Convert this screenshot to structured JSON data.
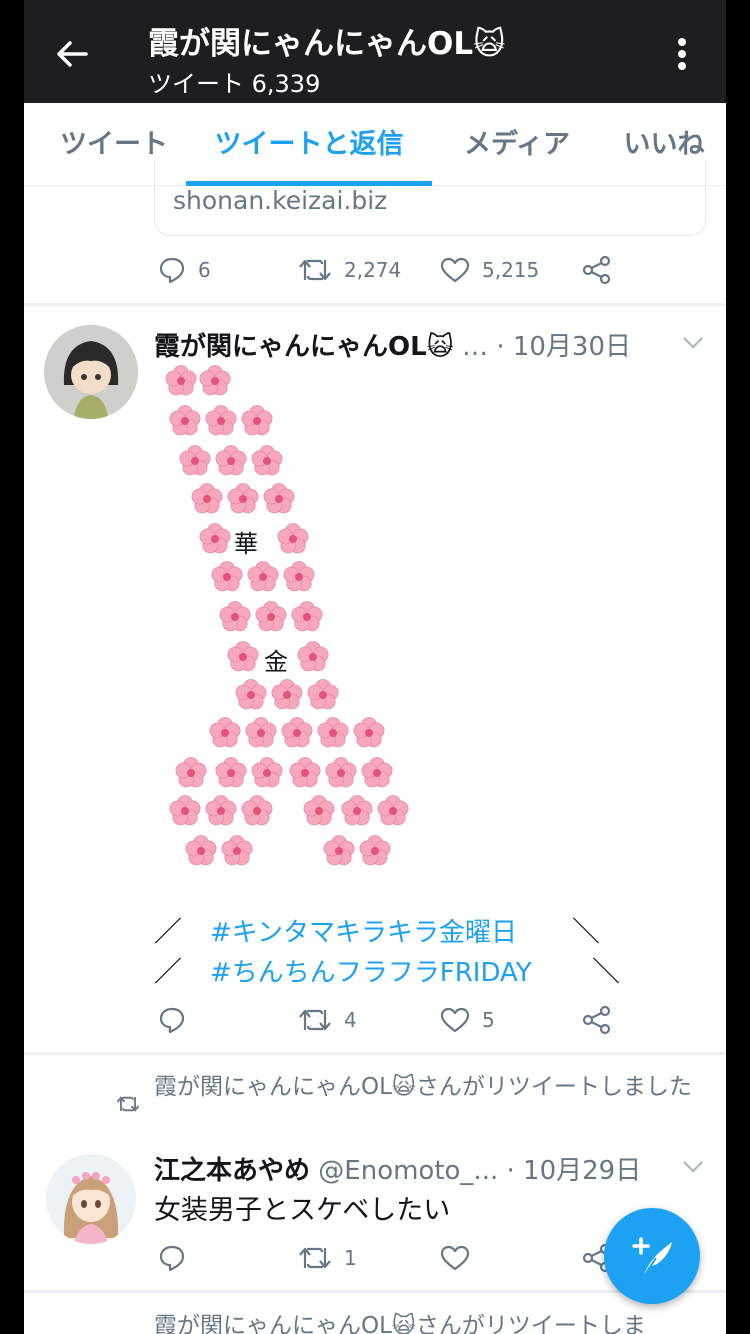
{
  "header": {
    "title": "霞が関にゃんにゃんOL🙀",
    "subtitle": "ツイート 6,339"
  },
  "tabs": [
    {
      "label": "ツイート"
    },
    {
      "label": "ツイートと返信"
    },
    {
      "label": "メディア"
    },
    {
      "label": "いいね"
    }
  ],
  "tweet1": {
    "link_domain": "shonan.keizai.biz",
    "replies": "6",
    "retweets": "2,274",
    "likes": "5,215"
  },
  "tweet2": {
    "name": "霞が関にゃんにゃんOL🙀",
    "ellipsis": "…",
    "date": "· 10月30日",
    "art_char_1": "華",
    "art_char_2": "金",
    "hashtag_1": "#キンタマキラキラ金曜日",
    "hashtag_2": "#ちんちんフラフラFRIDAY",
    "slash_open": "／",
    "slash_close": "＼",
    "replies": "",
    "retweets": "4",
    "likes": "5"
  },
  "tweet3": {
    "retweet_note": "霞が関にゃんにゃんOL🙀さんがリツイートしました",
    "name": "江之本あやめ",
    "handle": "@Enomoto_...",
    "date": "· 10月29日",
    "text": "女装男子とスケベしたい",
    "retweets": "1"
  },
  "tweet4": {
    "retweet_note": "霞が関にゃんにゃんOL🙀さんがリツイートしま"
  },
  "colors": {
    "accent": "#1da1f2",
    "header_bg": "#1c1e1f",
    "secondary_text": "#657786",
    "flower": "#f6a9bd"
  },
  "icons": [
    "back-arrow-icon",
    "more-vert-icon",
    "reply-icon",
    "retweet-icon",
    "like-icon",
    "share-icon",
    "chevron-down-icon",
    "compose-icon"
  ]
}
